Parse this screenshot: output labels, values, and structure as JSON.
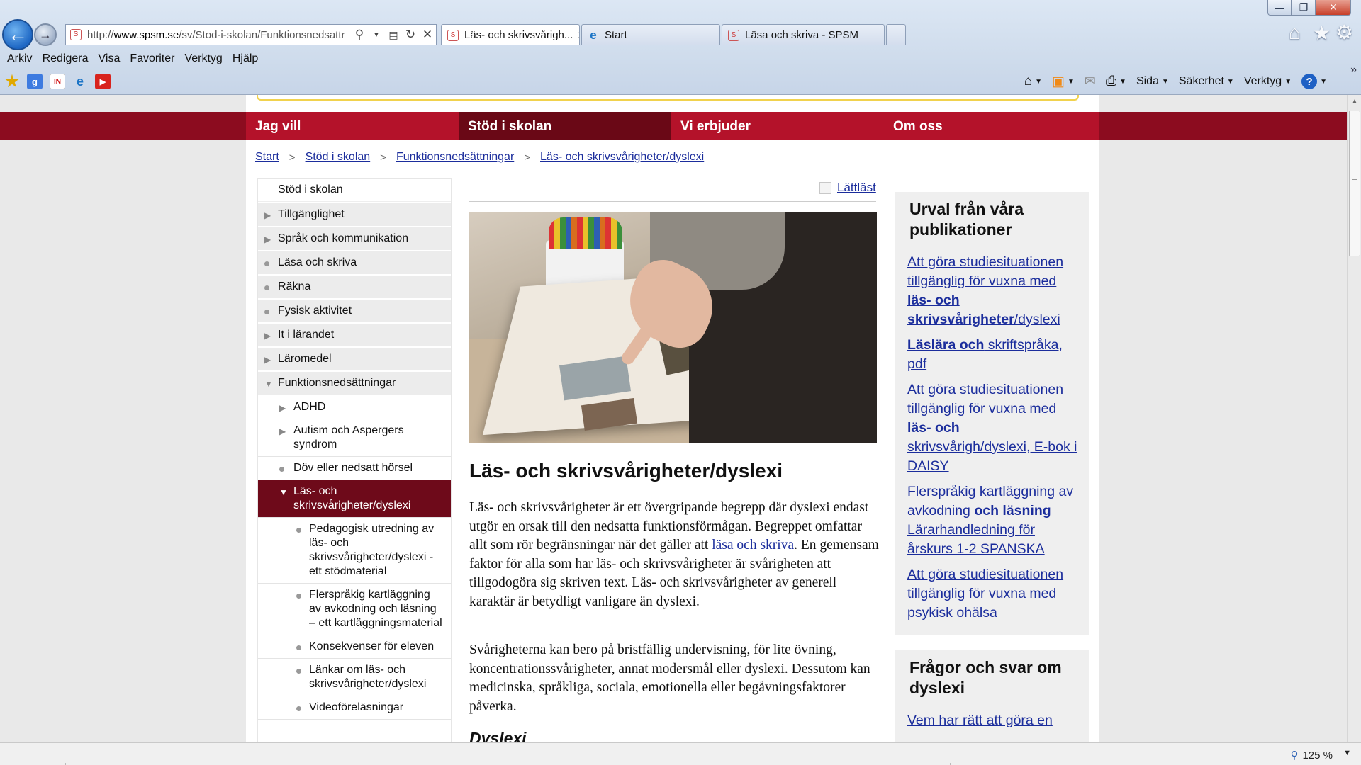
{
  "browser": {
    "address": {
      "url_prefix": "http://",
      "url_domain": "www.spsm.se",
      "url_path": "/sv/Stod-i-skolan/Funktionsnedsattr"
    },
    "tabs": [
      {
        "label": "Läs- och skrivsvårigh...",
        "active": true
      },
      {
        "label": "Start",
        "active": false
      },
      {
        "label": "Läsa och skriva - SPSM",
        "active": false
      }
    ],
    "menu": [
      "Arkiv",
      "Redigera",
      "Visa",
      "Favoriter",
      "Verktyg",
      "Hjälp"
    ],
    "commands": [
      "Sida",
      "Säkerhet",
      "Verktyg"
    ],
    "zoom": "125 %"
  },
  "site": {
    "main_nav": [
      "Jag vill",
      "Stöd i skolan",
      "Vi erbjuder",
      "Om oss"
    ],
    "breadcrumb": [
      "Start",
      "Stöd i skolan",
      "Funktionsnedsättningar",
      "Läs- och skrivsvårigheter/dyslexi"
    ],
    "sidebar": {
      "root": "Stöd i skolan",
      "items": [
        "Tillgänglighet",
        "Språk och kommunikation",
        "Läsa och skriva",
        "Räkna",
        "Fysisk aktivitet",
        "It i lärandet",
        "Läromedel",
        "Funktionsnedsättningar"
      ],
      "sub_items": [
        "ADHD",
        "Autism och Aspergers syndrom",
        "Döv eller nedsatt hörsel",
        "Läs- och skrivsvårigheter/dyslexi"
      ],
      "sub_sub_items": [
        "Pedagogisk utredning av läs- och skrivsvårigheter/dyslexi - ett stödmaterial",
        "Flerspråkig kartläggning av avkodning och läsning – ett kartläggningsmaterial",
        "Konsekvenser för eleven",
        "Länkar om läs- och skrivsvårigheter/dyslexi",
        "Videoföreläsningar"
      ]
    },
    "lattlast": "Lättläst",
    "article": {
      "title": "Läs- och skrivsvårigheter/dyslexi",
      "p1_a": "Läs- och skrivsvårigheter är ett övergripande begrepp där dyslexi endast utgör en orsak till den nedsatta funktionsförmågan. Begreppet omfattar allt som rör begränsningar när det gäller att ",
      "p1_link": "läsa och skriva",
      "p1_b": ". En gemensam faktor för alla som har läs- och skrivsvårigheter är svårigheten att tillgodogöra sig skriven text. Läs- och skrivsvårigheter av generell karaktär är betydligt vanligare än dyslexi.",
      "p2": "Svårigheterna kan bero på bristfällig undervisning, för lite övning, koncentrationssvårigheter, annat modersmål eller dyslexi. Dessutom kan medicinska, språkliga, sociala, emotionella eller begåvningsfaktorer påverka.",
      "subhead": "Dyslexi"
    },
    "publications": {
      "heading": "Urval från våra publikationer",
      "items": [
        {
          "a": "Att göra studiesituationen tillgänglig för vuxna med ",
          "b": "läs- och skrivsvårigheter",
          "c": "/dyslexi"
        },
        {
          "a": "",
          "b": "Läslära och",
          "c": " skriftspråka, pdf"
        },
        {
          "a": "Att göra studiesituationen tillgänglig för vuxna med ",
          "b": "läs- och",
          "c": " skrivsvårigh/dyslexi, E-bok i DAISY"
        },
        {
          "a": "Flerspråkig kartläggning av avkodning ",
          "b": "och läsning",
          "c": " Lärarhandledning för årskurs 1-2 SPANSKA"
        },
        {
          "a": "Att göra studiesituationen tillgänglig för vuxna med psykisk ohälsa",
          "b": "",
          "c": ""
        }
      ]
    },
    "faq": {
      "heading": "Frågor och svar om dyslexi",
      "first_link": "Vem har rätt att göra en"
    }
  }
}
